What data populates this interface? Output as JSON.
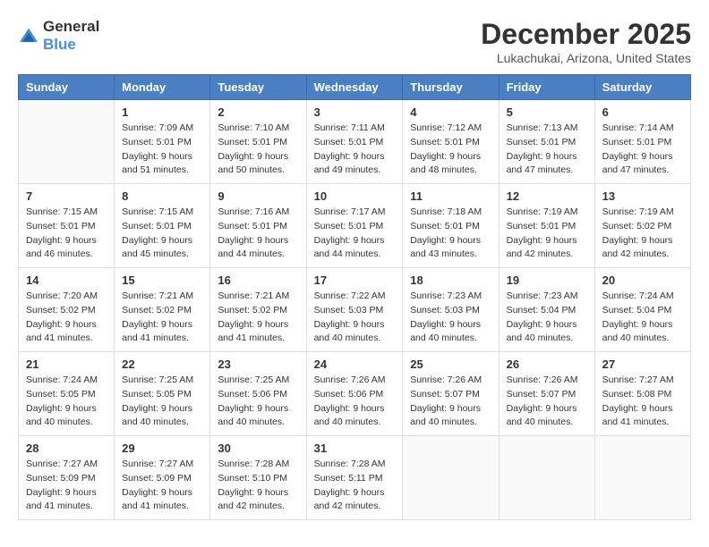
{
  "logo": {
    "line1": "General",
    "line2": "Blue"
  },
  "title": "December 2025",
  "location": "Lukachukai, Arizona, United States",
  "weekdays": [
    "Sunday",
    "Monday",
    "Tuesday",
    "Wednesday",
    "Thursday",
    "Friday",
    "Saturday"
  ],
  "weeks": [
    [
      {
        "day": "",
        "info": ""
      },
      {
        "day": "1",
        "info": "Sunrise: 7:09 AM\nSunset: 5:01 PM\nDaylight: 9 hours\nand 51 minutes."
      },
      {
        "day": "2",
        "info": "Sunrise: 7:10 AM\nSunset: 5:01 PM\nDaylight: 9 hours\nand 50 minutes."
      },
      {
        "day": "3",
        "info": "Sunrise: 7:11 AM\nSunset: 5:01 PM\nDaylight: 9 hours\nand 49 minutes."
      },
      {
        "day": "4",
        "info": "Sunrise: 7:12 AM\nSunset: 5:01 PM\nDaylight: 9 hours\nand 48 minutes."
      },
      {
        "day": "5",
        "info": "Sunrise: 7:13 AM\nSunset: 5:01 PM\nDaylight: 9 hours\nand 47 minutes."
      },
      {
        "day": "6",
        "info": "Sunrise: 7:14 AM\nSunset: 5:01 PM\nDaylight: 9 hours\nand 47 minutes."
      }
    ],
    [
      {
        "day": "7",
        "info": "Sunrise: 7:15 AM\nSunset: 5:01 PM\nDaylight: 9 hours\nand 46 minutes."
      },
      {
        "day": "8",
        "info": "Sunrise: 7:15 AM\nSunset: 5:01 PM\nDaylight: 9 hours\nand 45 minutes."
      },
      {
        "day": "9",
        "info": "Sunrise: 7:16 AM\nSunset: 5:01 PM\nDaylight: 9 hours\nand 44 minutes."
      },
      {
        "day": "10",
        "info": "Sunrise: 7:17 AM\nSunset: 5:01 PM\nDaylight: 9 hours\nand 44 minutes."
      },
      {
        "day": "11",
        "info": "Sunrise: 7:18 AM\nSunset: 5:01 PM\nDaylight: 9 hours\nand 43 minutes."
      },
      {
        "day": "12",
        "info": "Sunrise: 7:19 AM\nSunset: 5:01 PM\nDaylight: 9 hours\nand 42 minutes."
      },
      {
        "day": "13",
        "info": "Sunrise: 7:19 AM\nSunset: 5:02 PM\nDaylight: 9 hours\nand 42 minutes."
      }
    ],
    [
      {
        "day": "14",
        "info": "Sunrise: 7:20 AM\nSunset: 5:02 PM\nDaylight: 9 hours\nand 41 minutes."
      },
      {
        "day": "15",
        "info": "Sunrise: 7:21 AM\nSunset: 5:02 PM\nDaylight: 9 hours\nand 41 minutes."
      },
      {
        "day": "16",
        "info": "Sunrise: 7:21 AM\nSunset: 5:02 PM\nDaylight: 9 hours\nand 41 minutes."
      },
      {
        "day": "17",
        "info": "Sunrise: 7:22 AM\nSunset: 5:03 PM\nDaylight: 9 hours\nand 40 minutes."
      },
      {
        "day": "18",
        "info": "Sunrise: 7:23 AM\nSunset: 5:03 PM\nDaylight: 9 hours\nand 40 minutes."
      },
      {
        "day": "19",
        "info": "Sunrise: 7:23 AM\nSunset: 5:04 PM\nDaylight: 9 hours\nand 40 minutes."
      },
      {
        "day": "20",
        "info": "Sunrise: 7:24 AM\nSunset: 5:04 PM\nDaylight: 9 hours\nand 40 minutes."
      }
    ],
    [
      {
        "day": "21",
        "info": "Sunrise: 7:24 AM\nSunset: 5:05 PM\nDaylight: 9 hours\nand 40 minutes."
      },
      {
        "day": "22",
        "info": "Sunrise: 7:25 AM\nSunset: 5:05 PM\nDaylight: 9 hours\nand 40 minutes."
      },
      {
        "day": "23",
        "info": "Sunrise: 7:25 AM\nSunset: 5:06 PM\nDaylight: 9 hours\nand 40 minutes."
      },
      {
        "day": "24",
        "info": "Sunrise: 7:26 AM\nSunset: 5:06 PM\nDaylight: 9 hours\nand 40 minutes."
      },
      {
        "day": "25",
        "info": "Sunrise: 7:26 AM\nSunset: 5:07 PM\nDaylight: 9 hours\nand 40 minutes."
      },
      {
        "day": "26",
        "info": "Sunrise: 7:26 AM\nSunset: 5:07 PM\nDaylight: 9 hours\nand 40 minutes."
      },
      {
        "day": "27",
        "info": "Sunrise: 7:27 AM\nSunset: 5:08 PM\nDaylight: 9 hours\nand 41 minutes."
      }
    ],
    [
      {
        "day": "28",
        "info": "Sunrise: 7:27 AM\nSunset: 5:09 PM\nDaylight: 9 hours\nand 41 minutes."
      },
      {
        "day": "29",
        "info": "Sunrise: 7:27 AM\nSunset: 5:09 PM\nDaylight: 9 hours\nand 41 minutes."
      },
      {
        "day": "30",
        "info": "Sunrise: 7:28 AM\nSunset: 5:10 PM\nDaylight: 9 hours\nand 42 minutes."
      },
      {
        "day": "31",
        "info": "Sunrise: 7:28 AM\nSunset: 5:11 PM\nDaylight: 9 hours\nand 42 minutes."
      },
      {
        "day": "",
        "info": ""
      },
      {
        "day": "",
        "info": ""
      },
      {
        "day": "",
        "info": ""
      }
    ]
  ]
}
